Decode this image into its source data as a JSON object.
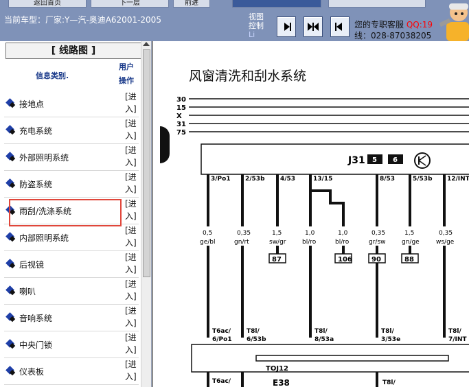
{
  "top_buttons": [
    "返回首页",
    "下一层",
    "前进"
  ],
  "car_info": "当前车型：厂家:Y—汽-奥迪A62001-2005",
  "view_control": "视图控制",
  "view_control_extra": "Li",
  "service": {
    "line1": "您的专职客服",
    "qq": "QQ:19",
    "line2": "线：028-87038205"
  },
  "sidebar": {
    "title": "[  线路图  ]",
    "col_category": "信息类别.",
    "col_action": "用户操作",
    "enter_label": "[进入]",
    "items": [
      {
        "label": "接地点"
      },
      {
        "label": "充电系统"
      },
      {
        "label": "外部照明系统"
      },
      {
        "label": "防盗系统"
      },
      {
        "label": "雨刮/洗涤系统"
      },
      {
        "label": "内部照明系统"
      },
      {
        "label": "后视镜"
      },
      {
        "label": "喇叭"
      },
      {
        "label": "音响系统"
      },
      {
        "label": "中央门锁"
      },
      {
        "label": "仪表板"
      }
    ]
  },
  "diagram": {
    "title": "风窗清洗和刮水系统",
    "rails": [
      "30",
      "15",
      "X",
      "31",
      "75"
    ],
    "module": {
      "name": "J31",
      "box1": "5",
      "box2": "6"
    },
    "pins": [
      "3/Po1",
      "2/53b",
      "4/53",
      "13/15",
      "8/53",
      "5/53b",
      "12/INT"
    ],
    "wire_sizes": [
      "0,5",
      "0,35",
      "1,5",
      "1,0",
      "1,0",
      "0,35",
      "1,5",
      "0,35"
    ],
    "wire_colors": [
      "ge/bl",
      "gn/rt",
      "sw/gr",
      "bl/ro",
      "bl/ro",
      "gr/sw",
      "gn/ge",
      "ws/ge"
    ],
    "refs": [
      "87",
      "106",
      "90",
      "88"
    ],
    "bottom_labels": [
      "T6ac/6/Po1",
      "T8l/6/53b",
      "T8l/8/53a",
      "T8l/3/53e",
      "T8l/7/INT"
    ],
    "component": "TOJ12",
    "component2": "E38",
    "bottom_label_extra": [
      "T6ac/",
      "T8l/"
    ]
  },
  "colors": {
    "toolbar": "#7f92b8",
    "highlight": "#e0463a",
    "qq": "#ff0000"
  }
}
